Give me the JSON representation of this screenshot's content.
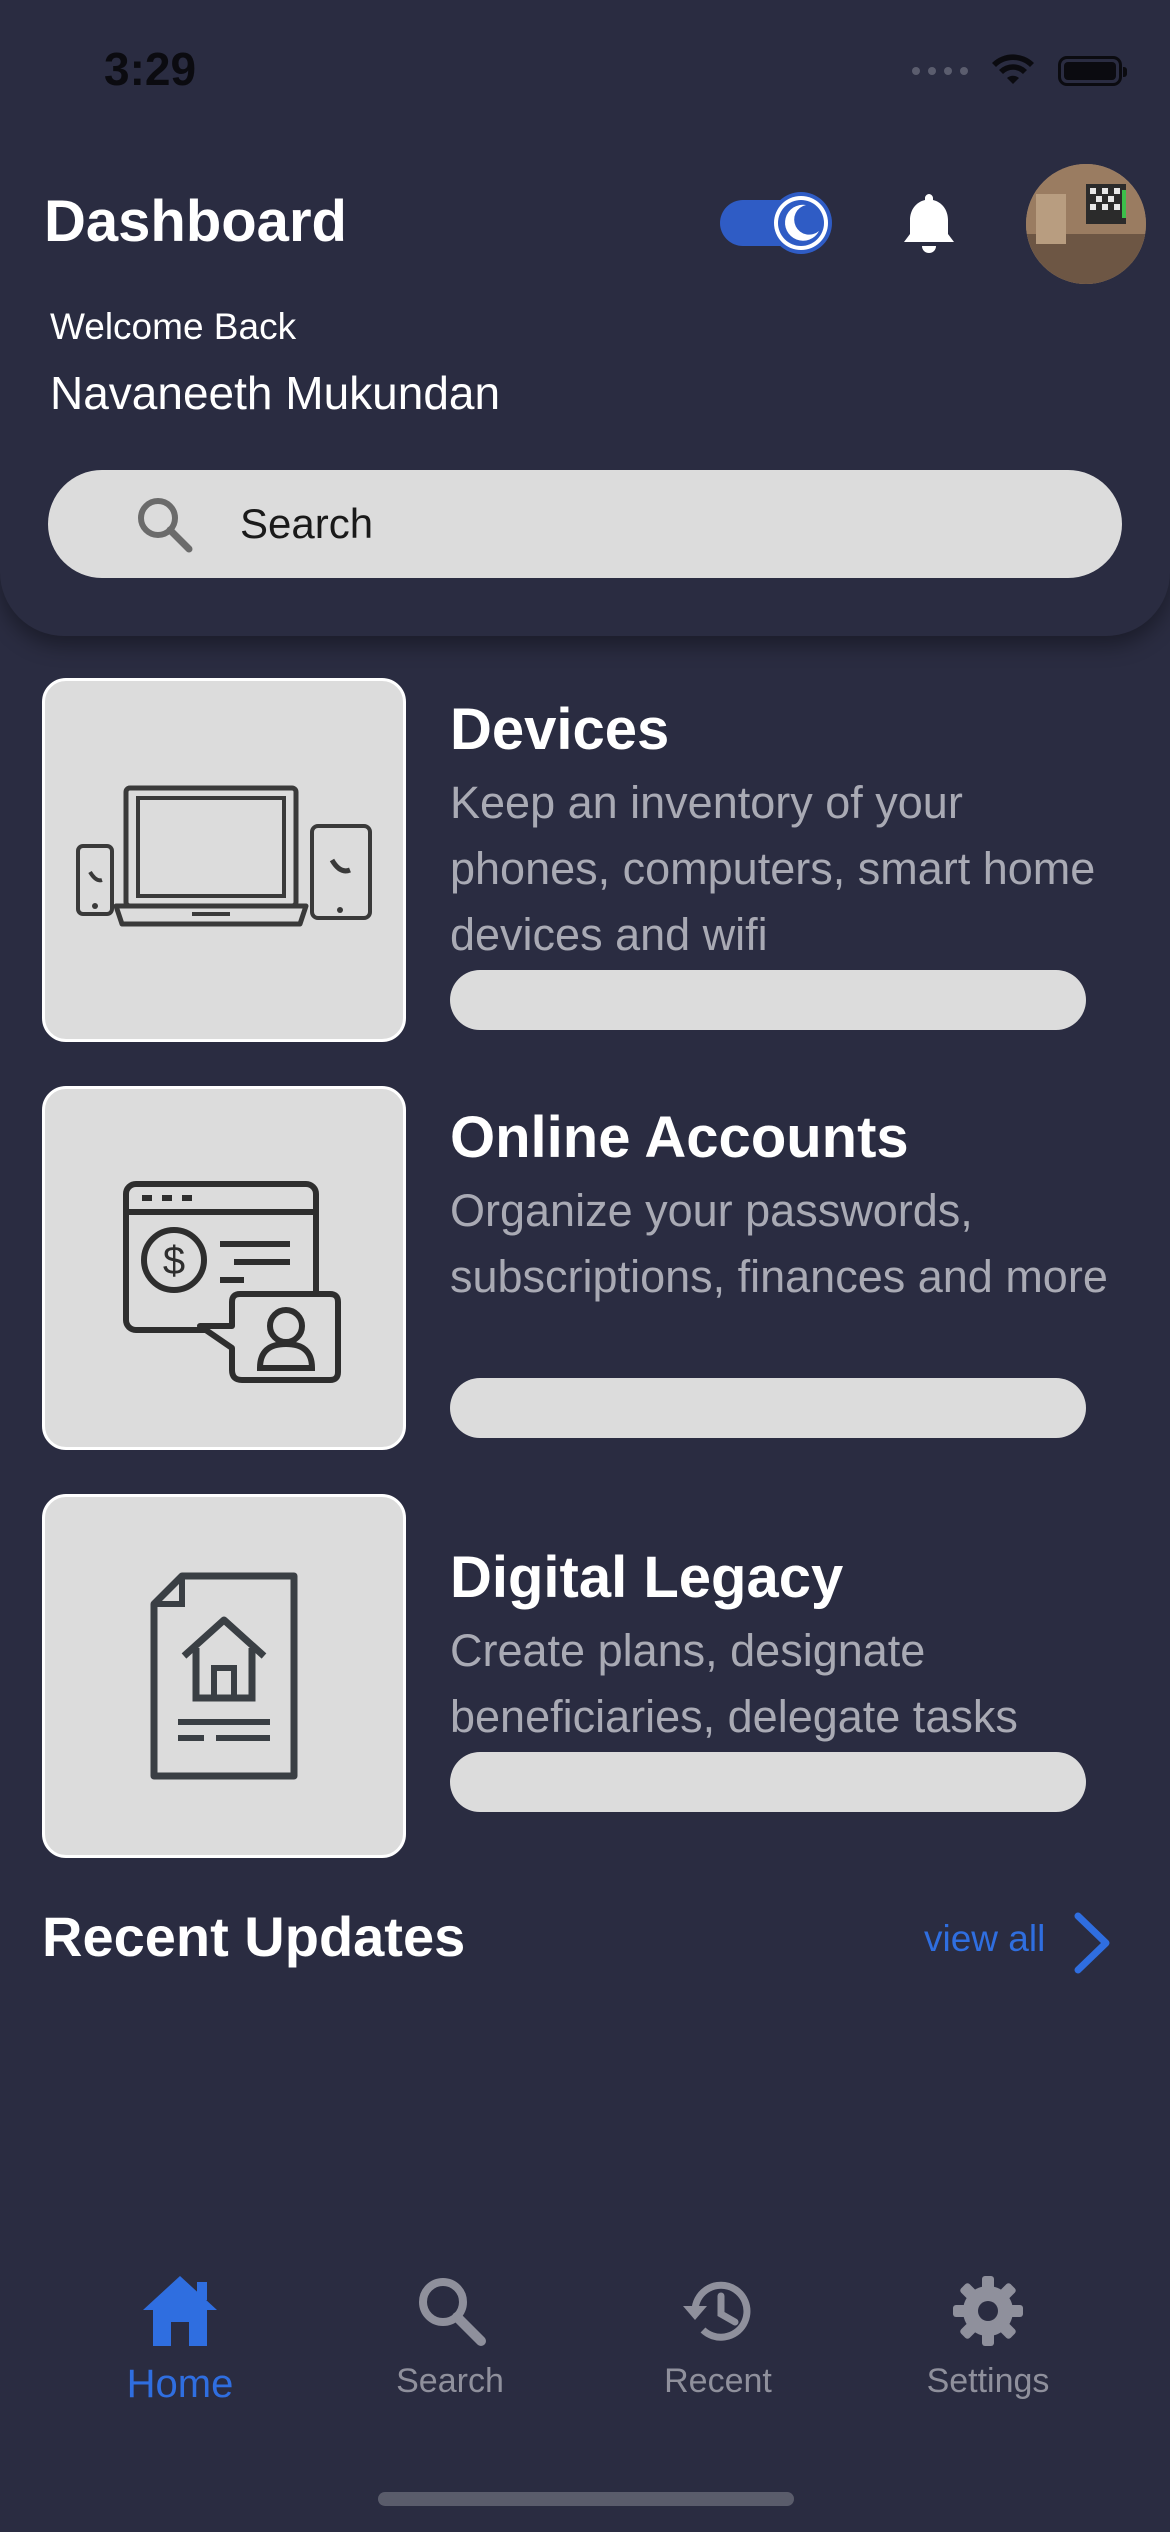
{
  "status_bar": {
    "time": "3:29"
  },
  "header": {
    "title": "Dashboard",
    "welcome": "Welcome Back",
    "user_name": "Navaneeth Mukundan",
    "dark_mode": true
  },
  "search": {
    "placeholder": "Search"
  },
  "cards": [
    {
      "title": "Devices",
      "description": "Keep an inventory of your phones, computers, smart home devices and wifi",
      "icon": "devices-icon"
    },
    {
      "title": "Online Accounts",
      "description": "Organize your passwords, subscriptions, finances and more",
      "icon": "online-account-icon"
    },
    {
      "title": "Digital Legacy",
      "description": "Create plans, designate beneficiaries, delegate tasks",
      "icon": "legacy-document-icon"
    }
  ],
  "recent_updates": {
    "title": "Recent Updates",
    "view_all": "view all"
  },
  "tab_bar": {
    "items": [
      {
        "label": "Home",
        "icon": "home-icon",
        "active": true
      },
      {
        "label": "Search",
        "icon": "search-icon",
        "active": false
      },
      {
        "label": "Recent",
        "icon": "history-icon",
        "active": false
      },
      {
        "label": "Settings",
        "icon": "gear-icon",
        "active": false
      }
    ]
  },
  "colors": {
    "background": "#2a2c41",
    "accent": "#2f6ee0",
    "card_surface": "#dcdcdc",
    "muted_text": "#a9aab4"
  }
}
